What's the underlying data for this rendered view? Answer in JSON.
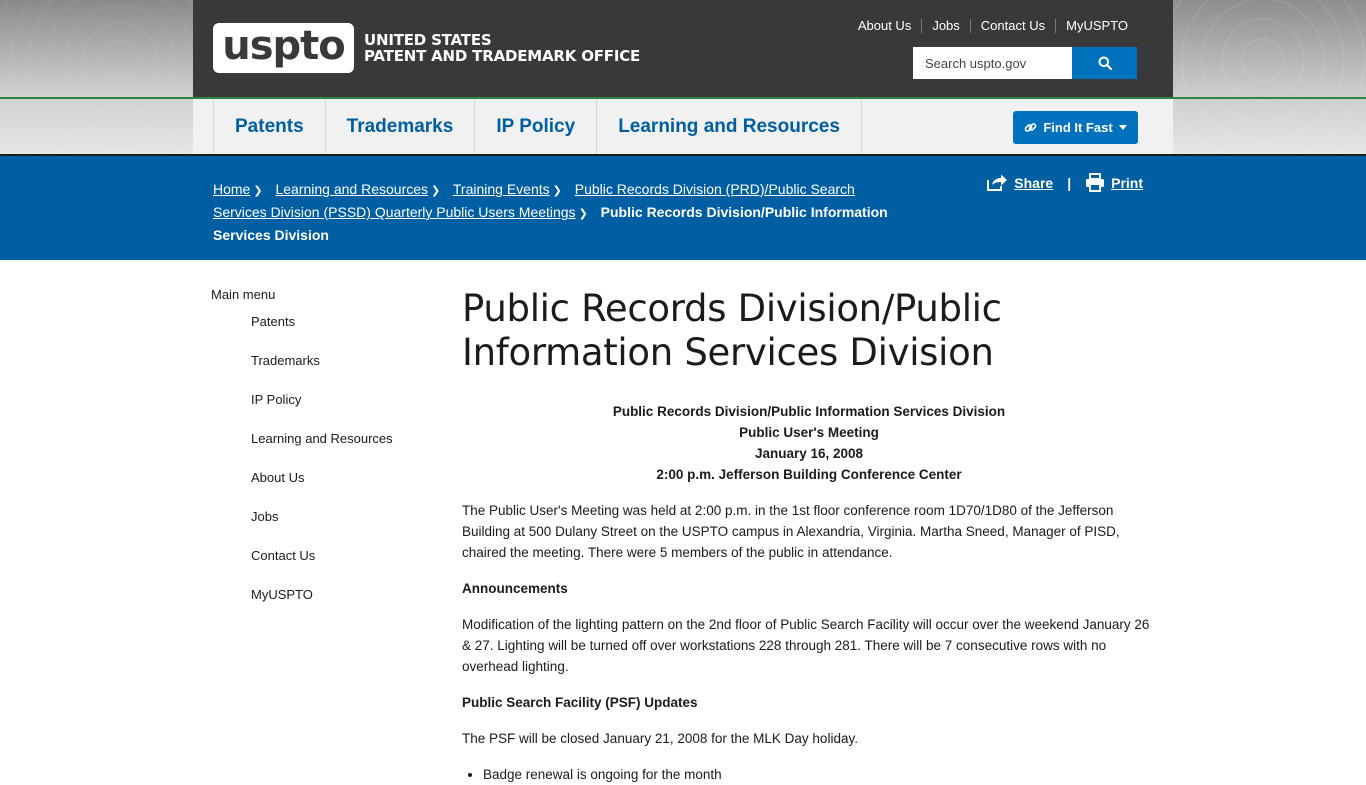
{
  "header": {
    "logo_text": "uspto",
    "agency_line1": "UNITED STATES",
    "agency_line2": "PATENT AND TRADEMARK OFFICE",
    "utility_links": [
      "About Us",
      "Jobs",
      "Contact Us",
      "MyUSPTO"
    ],
    "search": {
      "placeholder": "Search uspto.gov",
      "button_icon": "search-icon"
    }
  },
  "main_nav": {
    "items": [
      "Patents",
      "Trademarks",
      "IP Policy",
      "Learning and Resources"
    ],
    "find_it_fast": "Find It Fast"
  },
  "breadcrumb": {
    "links": [
      "Home",
      "Learning and Resources",
      "Training Events",
      "Public Records Division (PRD)/Public Search Services Division (PSSD) Quarterly Public Users Meetings"
    ],
    "current": "Public Records Division/Public Information Services Division"
  },
  "actions": {
    "share": "Share",
    "print": "Print"
  },
  "sidebar": {
    "title": "Main menu",
    "items": [
      "Patents",
      "Trademarks",
      "IP Policy",
      "Learning and Resources",
      "About Us",
      "Jobs",
      "Contact Us",
      "MyUSPTO"
    ]
  },
  "content": {
    "title": "Public Records Division/Public Information Services Division",
    "center_lines": [
      "Public Records Division/Public Information Services Division",
      "Public User's Meeting",
      "January 16, 2008",
      "2:00 p.m. Jefferson Building Conference Center"
    ],
    "intro": "The Public User's Meeting was held at 2:00 p.m. in the 1st floor conference room 1D70/1D80 of the Jefferson Building at 500 Dulany Street on the USPTO campus in Alexandria, Virginia. Martha Sneed, Manager of PISD, chaired the meeting. There were 5 members of the public in attendance.",
    "h_announcements": "Announcements",
    "announcements_text": "Modification of the lighting pattern on the 2nd floor of Public Search Facility will occur over the weekend January 26 & 27. Lighting will be turned off over workstations 228 through 281. There will be 7 consecutive rows with no overhead lighting.",
    "h_psf": "Public Search Facility (PSF) Updates",
    "psf_text": "The PSF will be closed January 21, 2008 for the MLK Day holiday.",
    "psf_bullets": [
      "Badge renewal is ongoing for the month"
    ]
  },
  "colors": {
    "masthead": "#393939",
    "accent_blue": "#005ea2",
    "button_blue": "#0071bc",
    "green_rule": "#2e8540"
  }
}
